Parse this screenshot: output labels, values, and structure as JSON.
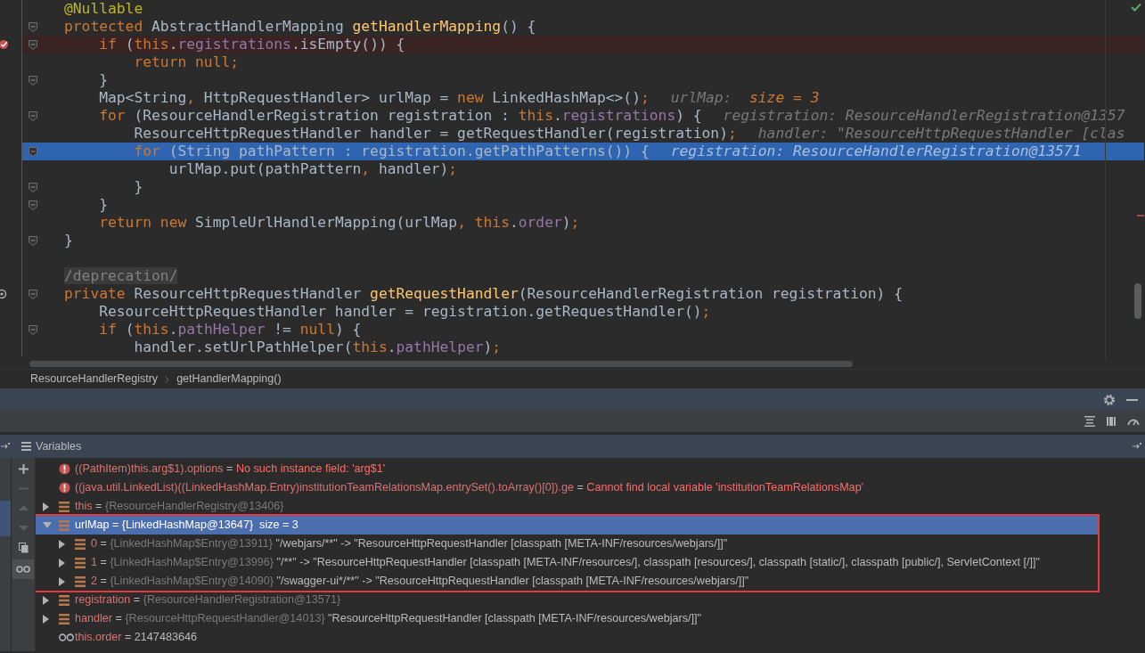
{
  "editor": {
    "lines": [
      {
        "fold": false,
        "breakpoint": false,
        "current": false,
        "override": false,
        "tokens": [
          {
            "kind": "annotation",
            "text": "@Nullable"
          }
        ]
      },
      {
        "fold": true,
        "breakpoint": false,
        "current": false,
        "override": false,
        "tokens": [
          {
            "kind": "keyword",
            "text": "protected "
          },
          {
            "kind": "plain",
            "text": "AbstractHandlerMapping "
          },
          {
            "kind": "method",
            "text": "getHandlerMapping"
          },
          {
            "kind": "plain",
            "text": "() {"
          }
        ]
      },
      {
        "fold": true,
        "breakpoint": true,
        "current": false,
        "override": false,
        "tokens": [
          {
            "kind": "keyword",
            "text": "    if "
          },
          {
            "kind": "plain",
            "text": "("
          },
          {
            "kind": "keyword",
            "text": "this"
          },
          {
            "kind": "plain",
            "text": "."
          },
          {
            "kind": "field",
            "text": "registrations"
          },
          {
            "kind": "plain",
            "text": ".isEmpty()) {"
          }
        ]
      },
      {
        "fold": false,
        "breakpoint": false,
        "current": false,
        "override": false,
        "tokens": [
          {
            "kind": "keyword",
            "text": "        return null"
          },
          {
            "kind": "punct",
            "text": ";"
          }
        ]
      },
      {
        "fold": true,
        "breakpoint": false,
        "current": false,
        "override": false,
        "tokens": [
          {
            "kind": "plain",
            "text": "    }"
          }
        ]
      },
      {
        "fold": false,
        "breakpoint": false,
        "current": false,
        "override": false,
        "tokens": [
          {
            "kind": "plain",
            "text": "    Map<String"
          },
          {
            "kind": "punct",
            "text": ", "
          },
          {
            "kind": "plain",
            "text": "HttpRequestHandler> urlMap = "
          },
          {
            "kind": "keyword",
            "text": "new "
          },
          {
            "kind": "plain",
            "text": "LinkedHashMap<>()"
          },
          {
            "kind": "punct",
            "text": ";"
          }
        ],
        "hint": [
          {
            "kind": "hint",
            "text": "urlMap:  "
          },
          {
            "kind": "hint-value",
            "text": "size = 3"
          }
        ]
      },
      {
        "fold": true,
        "breakpoint": false,
        "current": false,
        "override": false,
        "tokens": [
          {
            "kind": "keyword",
            "text": "    for "
          },
          {
            "kind": "plain",
            "text": "(ResourceHandlerRegistration registration : "
          },
          {
            "kind": "keyword",
            "text": "this"
          },
          {
            "kind": "plain",
            "text": "."
          },
          {
            "kind": "field",
            "text": "registrations"
          },
          {
            "kind": "plain",
            "text": ") {"
          }
        ],
        "hint": [
          {
            "kind": "hint",
            "text": "registration: ResourceHandlerRegistration@1357"
          }
        ]
      },
      {
        "fold": false,
        "breakpoint": false,
        "current": false,
        "override": false,
        "tokens": [
          {
            "kind": "plain",
            "text": "        ResourceHttpRequestHandler handler = getRequestHandler(registration)"
          },
          {
            "kind": "punct",
            "text": ";"
          }
        ],
        "hint": [
          {
            "kind": "hint",
            "text": "handler: \"ResourceHttpRequestHandler [clas"
          }
        ]
      },
      {
        "fold": true,
        "breakpoint": false,
        "current": true,
        "override": false,
        "tokens": [
          {
            "kind": "keyword",
            "text": "        for "
          },
          {
            "kind": "plain",
            "text": "(String pathPattern : registration.getPathPatterns()) {"
          }
        ],
        "hint": [
          {
            "kind": "hint",
            "text": "registration: ResourceHandlerRegistration@13571"
          }
        ]
      },
      {
        "fold": false,
        "breakpoint": false,
        "current": false,
        "override": false,
        "tokens": [
          {
            "kind": "plain",
            "text": "            urlMap.put(pathPattern"
          },
          {
            "kind": "punct",
            "text": ", "
          },
          {
            "kind": "plain",
            "text": "handler)"
          },
          {
            "kind": "punct",
            "text": ";"
          }
        ]
      },
      {
        "fold": true,
        "breakpoint": false,
        "current": false,
        "override": false,
        "tokens": [
          {
            "kind": "plain",
            "text": "        }"
          }
        ]
      },
      {
        "fold": true,
        "breakpoint": false,
        "current": false,
        "override": false,
        "tokens": [
          {
            "kind": "plain",
            "text": "    }"
          }
        ]
      },
      {
        "fold": false,
        "breakpoint": false,
        "current": false,
        "override": false,
        "tokens": [
          {
            "kind": "keyword",
            "text": "    return new "
          },
          {
            "kind": "plain",
            "text": "SimpleUrlHandlerMapping(urlMap"
          },
          {
            "kind": "punct",
            "text": ", "
          },
          {
            "kind": "keyword",
            "text": "this"
          },
          {
            "kind": "plain",
            "text": "."
          },
          {
            "kind": "field",
            "text": "order"
          },
          {
            "kind": "plain",
            "text": ")"
          },
          {
            "kind": "punct",
            "text": ";"
          }
        ]
      },
      {
        "fold": true,
        "breakpoint": false,
        "current": false,
        "override": false,
        "tokens": [
          {
            "kind": "plain",
            "text": "}"
          }
        ]
      },
      {
        "fold": false,
        "breakpoint": false,
        "current": false,
        "override": false
      },
      {
        "fold": false,
        "breakpoint": false,
        "current": false,
        "override": false,
        "tokens": [
          {
            "kind": "comment",
            "text": "/deprecation/"
          }
        ]
      },
      {
        "fold": true,
        "breakpoint": false,
        "current": false,
        "override": true,
        "tokens": [
          {
            "kind": "keyword",
            "text": "private "
          },
          {
            "kind": "plain",
            "text": "ResourceHttpRequestHandler "
          },
          {
            "kind": "method",
            "text": "getRequestHandler"
          },
          {
            "kind": "plain",
            "text": "(ResourceHandlerRegistration registration) {"
          }
        ]
      },
      {
        "fold": false,
        "breakpoint": false,
        "current": false,
        "override": false,
        "tokens": [
          {
            "kind": "plain",
            "text": "    ResourceHttpRequestHandler handler = registration.getRequestHandler()"
          },
          {
            "kind": "punct",
            "text": ";"
          }
        ]
      },
      {
        "fold": true,
        "breakpoint": false,
        "current": false,
        "override": false,
        "tokens": [
          {
            "kind": "keyword",
            "text": "    if "
          },
          {
            "kind": "plain",
            "text": "("
          },
          {
            "kind": "keyword",
            "text": "this"
          },
          {
            "kind": "plain",
            "text": "."
          },
          {
            "kind": "field",
            "text": "pathHelper "
          },
          {
            "kind": "plain",
            "text": "!= "
          },
          {
            "kind": "keyword",
            "text": "null"
          },
          {
            "kind": "plain",
            "text": ") {"
          }
        ]
      },
      {
        "fold": false,
        "breakpoint": false,
        "current": false,
        "override": false,
        "tokens": [
          {
            "kind": "plain",
            "text": "        handler.setUrlPathHelper("
          },
          {
            "kind": "keyword",
            "text": "this"
          },
          {
            "kind": "plain",
            "text": "."
          },
          {
            "kind": "field",
            "text": "pathHelper"
          },
          {
            "kind": "plain",
            "text": ")"
          },
          {
            "kind": "punct",
            "text": ";"
          }
        ]
      }
    ]
  },
  "breadcrumbs": [
    "ResourceHandlerRegistry",
    "getHandlerMapping()"
  ],
  "variables": {
    "title": "Variables",
    "items": [
      {
        "kind": "error",
        "name": "((PathItem)this.arg$1).options",
        "operator": "=",
        "value": "No such instance field: 'arg$1'"
      },
      {
        "kind": "error",
        "name": "((java.util.LinkedList)((LinkedHashMap.Entry)institutionTeamRelationsMap.entrySet().toArray()[0]).ge",
        "operator": "=",
        "value": "Cannot find local variable 'institutionTeamRelationsMap'"
      },
      {
        "kind": "field",
        "name": "this",
        "operator": "=",
        "type": "{ResourceHandlerRegistry@13406}",
        "expanded": false,
        "selected": false,
        "outlined": false
      },
      {
        "kind": "field",
        "name": "urlMap",
        "operator": "=",
        "type": "{LinkedHashMap@13647}",
        "value": "size = 3",
        "expanded": true,
        "selected": true,
        "outlined": true,
        "children": [
          {
            "kind": "field",
            "name": "0",
            "operator": "=",
            "type": "{LinkedHashMap$Entry@13911}",
            "value": "\"/webjars/**\" -> \"ResourceHttpRequestHandler [classpath [META-INF/resources/webjars/]]\"",
            "expanded": false,
            "selected": false
          },
          {
            "kind": "field",
            "name": "1",
            "operator": "=",
            "type": "{LinkedHashMap$Entry@13996}",
            "value": "\"/**\" -> \"ResourceHttpRequestHandler [classpath [META-INF/resources/], classpath [resources/], classpath [static/], classpath [public/], ServletContext [/]]\"",
            "expanded": false,
            "selected": false
          },
          {
            "kind": "field",
            "name": "2",
            "operator": "=",
            "type": "{LinkedHashMap$Entry@14090}",
            "value": "\"/swagger-ui*/**\" -> \"ResourceHttpRequestHandler [classpath [META-INF/resources/webjars/]]\"",
            "expanded": false,
            "selected": false
          }
        ]
      },
      {
        "kind": "field",
        "name": "registration",
        "operator": "=",
        "type": "{ResourceHandlerRegistration@13571}",
        "expanded": false,
        "selected": false,
        "outlined": false
      },
      {
        "kind": "field",
        "name": "handler",
        "operator": "=",
        "type": "{ResourceHttpRequestHandler@14013}",
        "value": "\"ResourceHttpRequestHandler [classpath [META-INF/resources/webjars/]]\"",
        "expanded": false,
        "selected": false,
        "outlined": false
      },
      {
        "kind": "watch",
        "name": "this.order",
        "operator": "=",
        "value": "2147483646"
      }
    ]
  }
}
